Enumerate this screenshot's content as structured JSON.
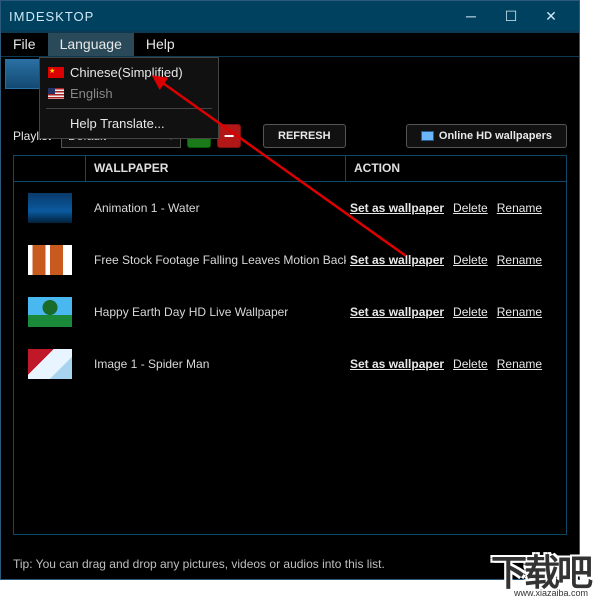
{
  "titlebar": {
    "title": "IMDESKTOP"
  },
  "menubar": {
    "file": "File",
    "language": "Language",
    "help": "Help"
  },
  "dropdown": {
    "chinese": "Chinese(Simplified)",
    "english": "English",
    "helpTranslate": "Help Translate..."
  },
  "toolbar": {
    "playlist_label": "Playlist",
    "playlist_value": "Default",
    "refresh": "REFRESH",
    "onlineHd": "Online HD wallpapers"
  },
  "table": {
    "header": {
      "wallpaper": "WALLPAPER",
      "action": "ACTION"
    },
    "rows": [
      {
        "name": "Animation 1 - Water",
        "thumbBg": "linear-gradient(#0a3a6a,#0a5aa0 60%,#02203a)"
      },
      {
        "name": "Free Stock Footage Falling Leaves Motion Backg",
        "thumbBg": "linear-gradient(90deg,#fff 0 10%,#c85a20 10% 40%,#fff 40% 50%,#c85a20 50% 80%,#fff 80%)"
      },
      {
        "name": "Happy Earth Day HD Live Wallpaper",
        "thumbBg": "radial-gradient(circle at 50% 35%,#1a6a2a 0 25%,transparent 26%),linear-gradient(#4ab8f0,#4ab8f0 60%,#1a8a3a 60%)"
      },
      {
        "name": "Image 1 - Spider Man",
        "thumbBg": "linear-gradient(135deg,#c01828 0 35%,#e8f4ff 35% 70%,#a8d4f0 70%)"
      }
    ],
    "actions": {
      "set": "Set as wallpaper",
      "delete": "Delete",
      "rename": "Rename"
    }
  },
  "tip": "Tip: You can drag and drop any pictures, videos or audios into this list.",
  "watermark": {
    "text": "下载吧",
    "url": "www.xiazaiba.com"
  }
}
